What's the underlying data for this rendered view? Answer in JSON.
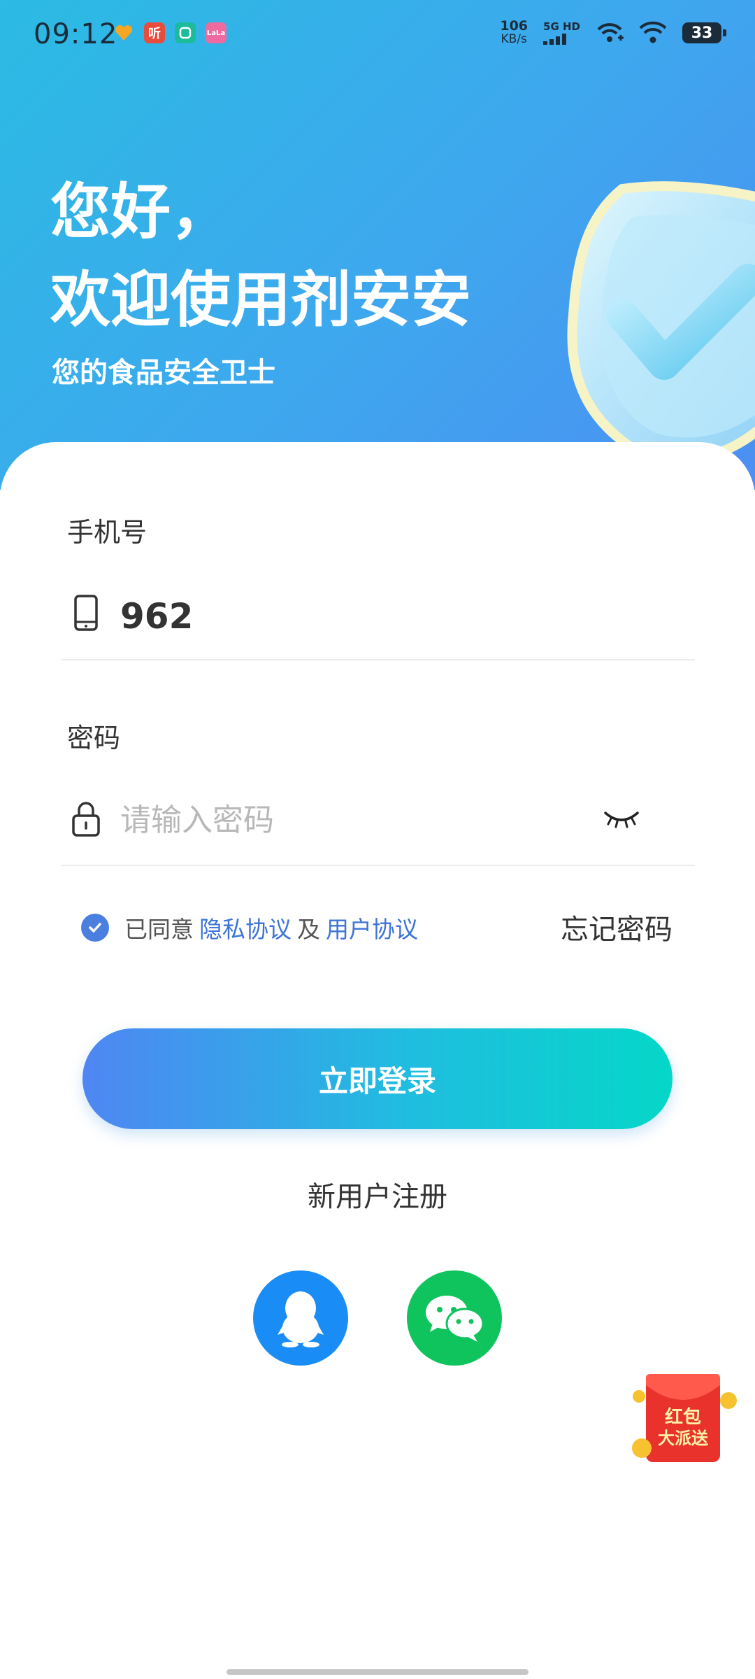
{
  "status_bar": {
    "time": "09:12",
    "notifications": [
      {
        "icon": "heart-app-icon",
        "text": "",
        "color": "#f5a623"
      },
      {
        "icon": "listen-app-icon",
        "text": "听",
        "color": "#e74c3c"
      },
      {
        "icon": "mi-home-app-icon",
        "text": "",
        "color": "#1abc9c"
      },
      {
        "icon": "lala-app-icon",
        "text": "LaLa",
        "color": "#ef6aa0"
      }
    ],
    "net_speed_value": "106",
    "net_speed_unit": "KB/s",
    "signal_label": "5G HD",
    "battery": "33"
  },
  "hero": {
    "greeting": "您好，",
    "welcome": "欢迎使用剂安安",
    "subtitle": "您的食品安全卫士"
  },
  "form": {
    "phone_label": "手机号",
    "phone_value": "962",
    "password_label": "密码",
    "password_placeholder": "请输入密码"
  },
  "agreement": {
    "prefix": "已同意",
    "privacy_link": "隐私协议",
    "and": "及",
    "user_link": "用户协议",
    "forgot": "忘记密码"
  },
  "actions": {
    "login": "立即登录",
    "register": "新用户注册"
  },
  "promo": {
    "line1": "红包",
    "line2": "大派送"
  },
  "colors": {
    "accent": "#4a7fe0",
    "qq": "#1a8cf5",
    "wechat": "#0fc35d"
  }
}
